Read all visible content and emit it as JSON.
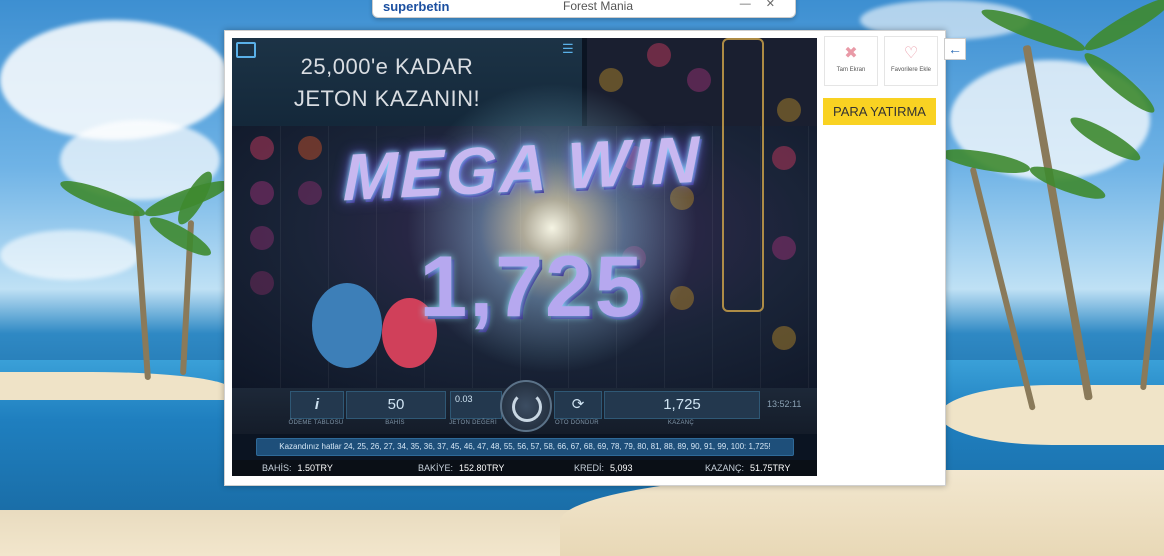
{
  "browser": {
    "brand": "superbetin",
    "tab_title": "Forest Mania",
    "controls": "— ✕"
  },
  "game": {
    "promo_line1": "25,000'e KADAR",
    "promo_line2": "JETON KAZANIN!",
    "mega_text": "MEGA WIN",
    "win_amount": "1,725",
    "controls": {
      "info_label": "ÖDEME TABLOSU",
      "bet_value": "50",
      "bet_label": "BAHİS",
      "coin_value": "0.03",
      "coin_label": "JETON DEĞERİ",
      "auto_label": "OTO DÖNDÜR",
      "win_value": "1,725",
      "win_label": "KAZANÇ",
      "clock": "13:52:11"
    },
    "lines_message": "Kazandınız hatlar 24, 25, 26, 27, 34, 35, 36, 37, 45, 46, 47, 48, 55, 56, 57, 58, 66, 67, 68, 69, 78, 79, 80, 81, 88, 89, 90, 91, 99, 100: 1,725!",
    "stats": {
      "bet_key": "BAHİS:",
      "bet_val": "1.50TRY",
      "balance_key": "BAKİYE:",
      "balance_val": "152.80TRY",
      "credit_key": "KREDİ:",
      "credit_val": "5,093",
      "win_key": "KAZANÇ:",
      "win_val": "51.75TRY"
    }
  },
  "sidebar": {
    "fullscreen_label": "Tam Ekran",
    "favorite_label": "Favorilere Ekle",
    "deposit_label": "PARA YATIRMA"
  },
  "colors": {
    "accent": "#f9d222",
    "panel": "#ffffff",
    "game_bg": "#0b1422"
  }
}
